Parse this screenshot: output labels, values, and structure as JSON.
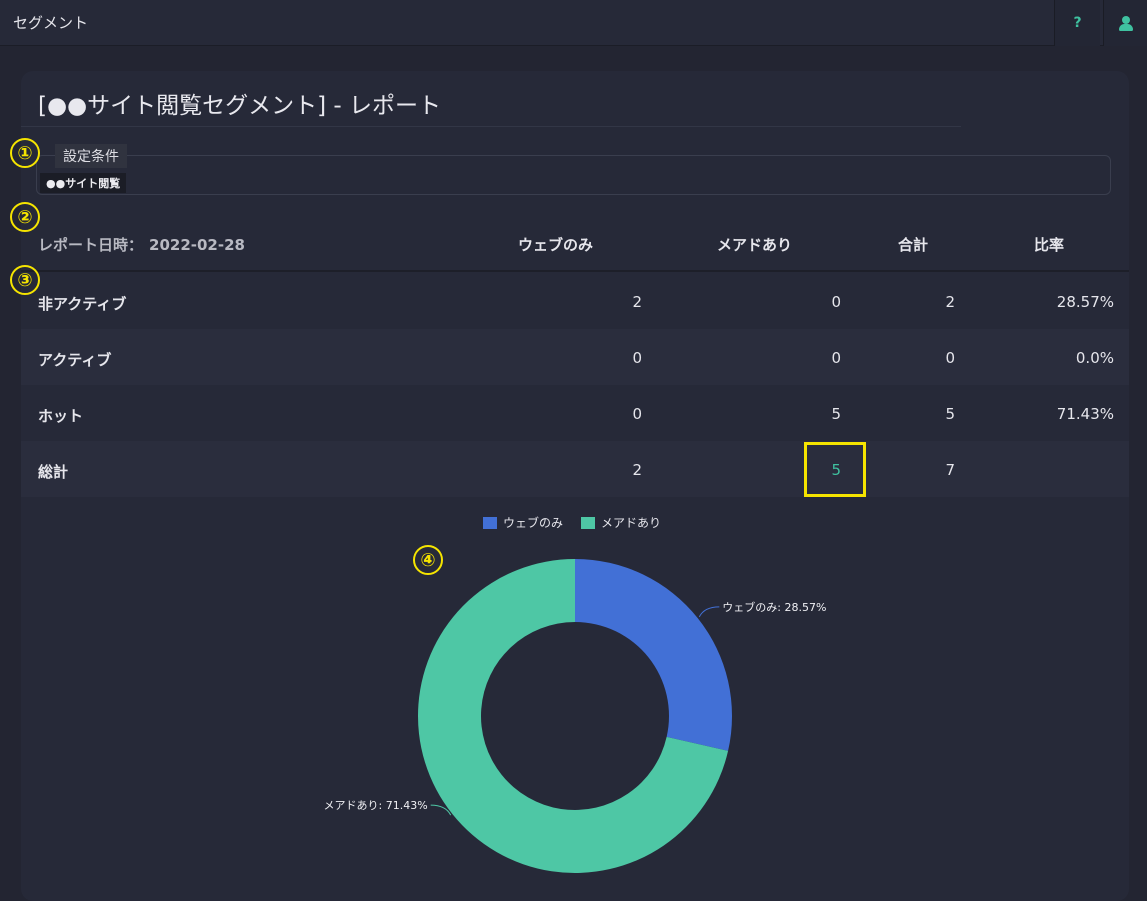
{
  "app": {
    "title": "セグメント"
  },
  "toolbar": {
    "help_label": "?"
  },
  "report": {
    "title": "[●●サイト閲覧セグメント] - レポート",
    "condition_legend": "設定条件",
    "condition_tag": "●●サイト閲覧",
    "date_label": "レポート日時：",
    "date_value": "2022-02-28"
  },
  "table": {
    "columns": [
      "ウェブのみ",
      "メアドあり",
      "合計",
      "比率"
    ],
    "rows": [
      {
        "label": "非アクティブ",
        "web": "2",
        "mail": "0",
        "total": "2",
        "ratio": "28.57%"
      },
      {
        "label": "アクティブ",
        "web": "0",
        "mail": "0",
        "total": "0",
        "ratio": "0.0%"
      },
      {
        "label": "ホット",
        "web": "0",
        "mail": "5",
        "total": "5",
        "ratio": "71.43%"
      },
      {
        "label": "総計",
        "web": "2",
        "mail": "5",
        "total": "7",
        "ratio": ""
      }
    ]
  },
  "annotations": [
    "①",
    "②",
    "③",
    "④"
  ],
  "colors": {
    "accent": "#3fc1a0",
    "highlight": "#f5e400",
    "web": "#4270d6",
    "mail": "#4ec7a5"
  },
  "chart_data": {
    "type": "pie",
    "donut": true,
    "legend_position": "top-center",
    "categories": [
      "ウェブのみ",
      "メアドあり"
    ],
    "values": [
      28.57,
      71.43
    ],
    "labels": [
      "ウェブのみ: 28.57%",
      "メアドあり: 71.43%"
    ],
    "colors": [
      "#4270d6",
      "#4ec7a5"
    ]
  }
}
